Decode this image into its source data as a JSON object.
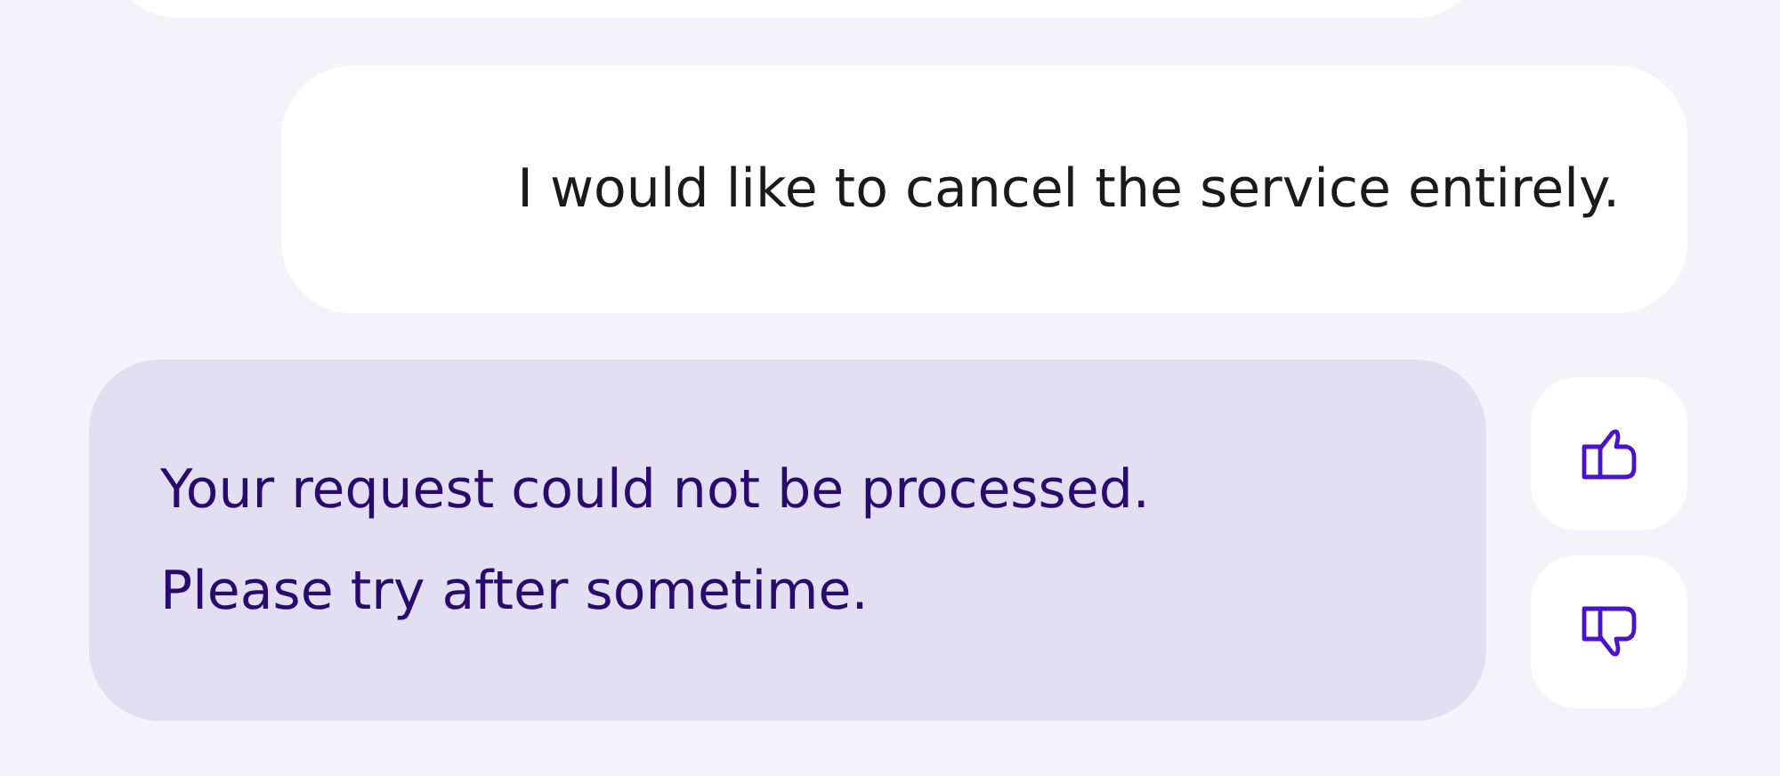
{
  "messages": [
    {
      "kind": "clipped"
    },
    {
      "kind": "user",
      "lines": [
        "I would like to cancel the service entirely."
      ]
    },
    {
      "kind": "bot",
      "lines": [
        "Your request could not be processed.",
        "Please try after sometime."
      ],
      "feedback": [
        {
          "kind": "thumbs_up"
        },
        {
          "kind": "thumbs_down"
        }
      ]
    }
  ]
}
